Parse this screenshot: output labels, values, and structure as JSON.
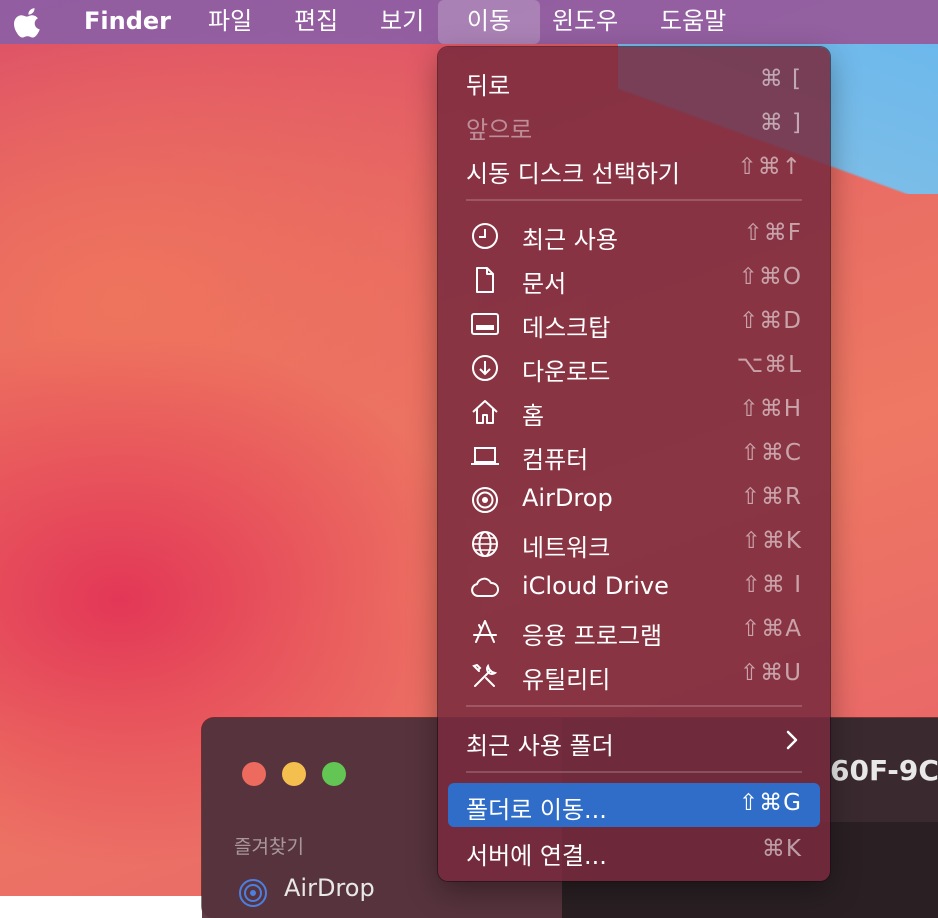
{
  "menubar": {
    "app": "Finder",
    "items": [
      "파일",
      "편집",
      "보기",
      "이동",
      "윈도우",
      "도움말"
    ],
    "active_index": 3
  },
  "menu": {
    "items": [
      {
        "label": "뒤로",
        "shortcut": "⌘ [",
        "enabled": true
      },
      {
        "label": "앞으로",
        "shortcut": "⌘ ]",
        "enabled": false
      },
      {
        "label": "시동 디스크 선택하기",
        "shortcut": "⇧⌘↑",
        "enabled": true
      },
      {
        "label": "최근 사용",
        "shortcut": "⇧⌘F",
        "icon": "clock-icon"
      },
      {
        "label": "문서",
        "shortcut": "⇧⌘O",
        "icon": "document-icon"
      },
      {
        "label": "데스크탑",
        "shortcut": "⇧⌘D",
        "icon": "desktop-icon"
      },
      {
        "label": "다운로드",
        "shortcut": "⌥⌘L",
        "icon": "download-icon"
      },
      {
        "label": "홈",
        "shortcut": "⇧⌘H",
        "icon": "home-icon"
      },
      {
        "label": "컴퓨터",
        "shortcut": "⇧⌘C",
        "icon": "laptop-icon"
      },
      {
        "label": "AirDrop",
        "shortcut": "⇧⌘R",
        "icon": "airdrop-icon"
      },
      {
        "label": "네트워크",
        "shortcut": "⇧⌘K",
        "icon": "globe-icon"
      },
      {
        "label": "iCloud Drive",
        "shortcut": "⇧⌘ I",
        "icon": "cloud-icon"
      },
      {
        "label": "응용 프로그램",
        "shortcut": "⇧⌘A",
        "icon": "apps-icon"
      },
      {
        "label": "유틸리티",
        "shortcut": "⇧⌘U",
        "icon": "utilities-icon"
      },
      {
        "label": "최근 사용 폴더",
        "submenu": true
      },
      {
        "label": "폴더로 이동...",
        "shortcut": "⇧⌘G",
        "highlighted": true
      },
      {
        "label": "서버에 연결...",
        "shortcut": "⌘K"
      }
    ]
  },
  "finder_window": {
    "title_fragment": "60F-9C",
    "sidebar_section": "즐겨찾기",
    "sidebar_first_item": "AirDrop"
  },
  "colors": {
    "menubar": "#8760a8",
    "menu_bg": "#782a3e",
    "highlight": "#2f6dc8",
    "close": "#ed6a5e",
    "minimize": "#f5bf4f",
    "zoom": "#62c554"
  }
}
